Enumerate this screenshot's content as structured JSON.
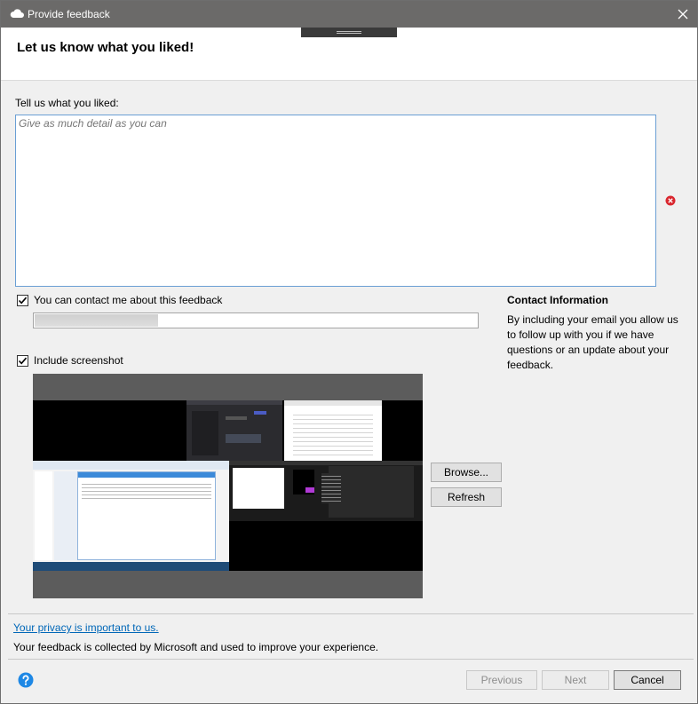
{
  "window": {
    "title": "Provide feedback",
    "title_icon": "cloud-icon",
    "close_icon": "close-icon"
  },
  "header": {
    "title": "Let us know what you liked!"
  },
  "feedback": {
    "label": "Tell us what you liked:",
    "placeholder": "Give as much detail as you can",
    "value": "",
    "error_icon": "error-icon"
  },
  "contact": {
    "checkbox_label": "You can contact me about this feedback",
    "checked": true,
    "email_value": "",
    "info_title": "Contact Information",
    "info_text": "By including your email you allow us to follow up with you if we have questions or an update about your feedback."
  },
  "screenshot": {
    "checkbox_label": "Include screenshot",
    "checked": true,
    "browse_label": "Browse...",
    "refresh_label": "Refresh"
  },
  "privacy": {
    "link_text": "Your privacy is important to us.",
    "notice": "Your feedback is collected by Microsoft and used to improve your experience."
  },
  "footer": {
    "help_icon": "help-icon",
    "previous_label": "Previous",
    "next_label": "Next",
    "cancel_label": "Cancel"
  },
  "colors": {
    "titlebar": "#6b6a69",
    "link": "#0067b8",
    "error": "#d9262e",
    "help": "#1e88e5",
    "input_focus_border": "#6a9fd4"
  }
}
